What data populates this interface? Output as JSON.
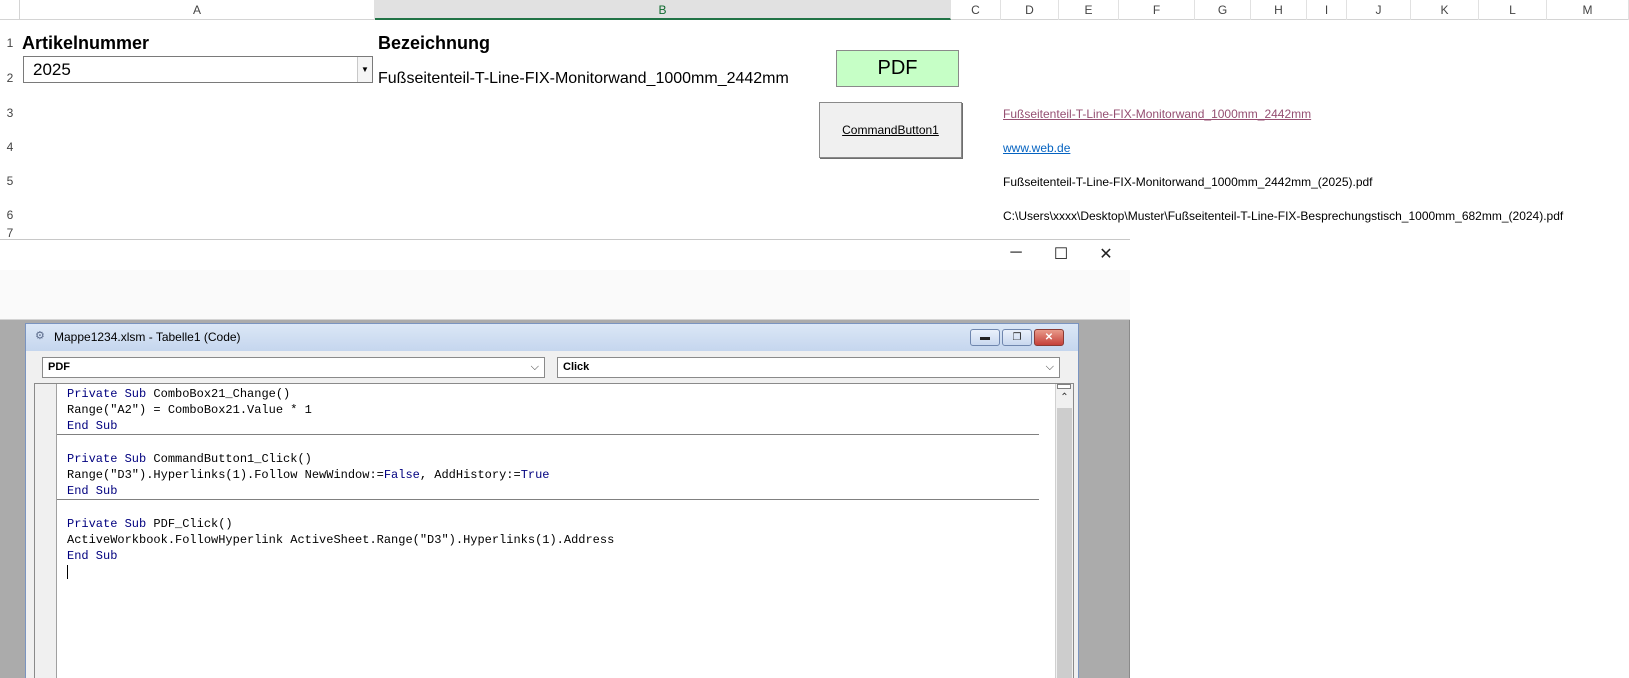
{
  "sheet": {
    "columns": [
      "A",
      "B",
      "C",
      "D",
      "E",
      "F",
      "G",
      "H",
      "I",
      "J",
      "K",
      "L",
      "M"
    ],
    "rows": [
      "1",
      "2",
      "3",
      "4",
      "5",
      "6",
      "7"
    ],
    "a1": "Artikelnummer",
    "b1": "Bezeichnung",
    "combo_value": "2025",
    "b2": "Fußseitenteil-T-Line-FIX-Monitorwand_1000mm_2442mm",
    "pdf_button": "PDF",
    "command_button": "CommandButton1",
    "d3": "Fußseitenteil-T-Line-FIX-Monitorwand_1000mm_2442mm",
    "d4": "www.web.de",
    "d5": "Fußseitenteil-T-Line-FIX-Monitorwand_1000mm_2442mm_(2025).pdf",
    "d6": "C:\\Users\\xxxx\\Desktop\\Muster\\Fußseitenteil-T-Line-FIX-Besprechungstisch_1000mm_682mm_(2024).pdf"
  },
  "vbe": {
    "minimize": "─",
    "maximize": "☐",
    "close": "✕"
  },
  "code_window": {
    "title": "Mappe1234.xlsm - Tabelle1 (Code)",
    "object_dropdown": "PDF",
    "procedure_dropdown": "Click",
    "proc1": {
      "l1_kw": "Private Sub",
      "l1_rest": " ComboBox21_Change()",
      "l2": "Range(\"A2\") = ComboBox21.Value * 1",
      "l3": "End Sub"
    },
    "proc2": {
      "l1_kw": "Private Sub",
      "l1_rest": " CommandButton1_Click()",
      "l2_a": "Range(\"D3\").Hyperlinks(1).Follow NewWindow:=",
      "l2_false": "False",
      "l2_b": ", AddHistory:=",
      "l2_true": "True",
      "l3": "End Sub"
    },
    "proc3": {
      "l1_kw": "Private Sub",
      "l1_rest": " PDF_Click()",
      "l2": "ActiveWorkbook.FollowHyperlink ActiveSheet.Range(\"D3\").Hyperlinks(1).Address",
      "l3": "End Sub"
    }
  },
  "colors": {
    "pdf_button_bg": "#c6ffc6",
    "keyword": "#00007f",
    "visited_link": "#954f72",
    "link": "#0563c1"
  }
}
